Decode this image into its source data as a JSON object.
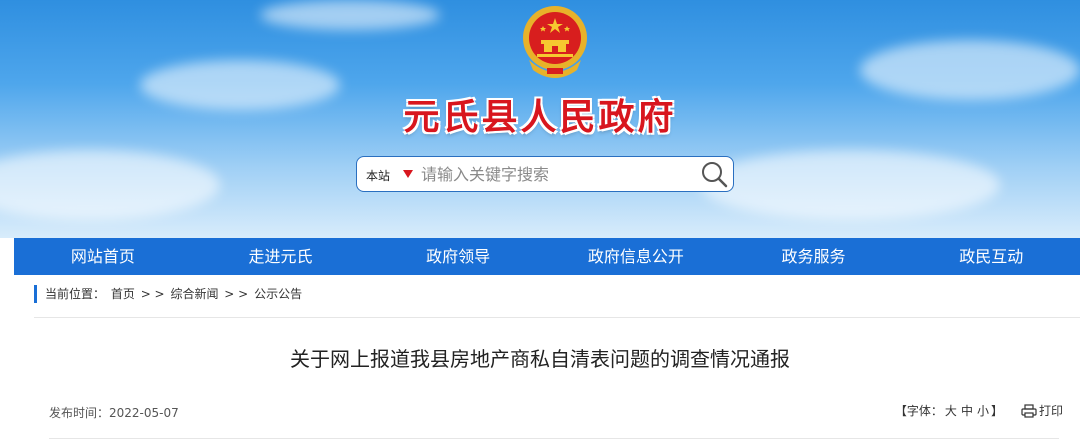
{
  "header": {
    "site_title": "元氏县人民政府",
    "emblem_icon": "national-emblem-icon"
  },
  "search": {
    "scope_label": "本站",
    "placeholder": "请输入关键字搜索"
  },
  "nav": {
    "items": [
      "网站首页",
      "走进元氏",
      "政府领导",
      "政府信息公开",
      "政务服务",
      "政民互动"
    ]
  },
  "breadcrumb": {
    "prefix": "当前位置：",
    "home": "首页",
    "sep": "> >",
    "section": "综合新闻",
    "current": "公示公告"
  },
  "article": {
    "title": "关于网上报道我县房地产商私自清表问题的调查情况通报",
    "date_label": "发布时间：",
    "date": "2022-05-07",
    "font_open": "【字体：",
    "font_sizes": [
      "大",
      "中",
      "小"
    ],
    "font_close": "】",
    "print_label": "打印"
  },
  "colors": {
    "nav_bg": "#1a6fd6",
    "title_red": "#d8161e"
  }
}
